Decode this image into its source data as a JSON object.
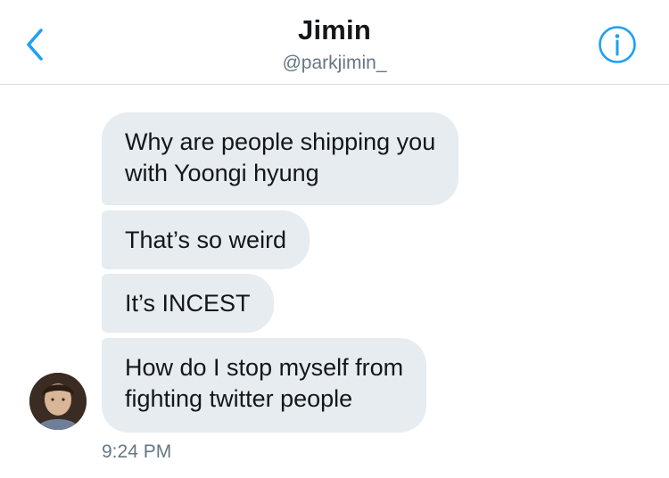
{
  "header": {
    "back_icon": "chevron-left-icon",
    "title": "Jimin",
    "subtitle": "@parkjimin_",
    "info_icon": "info-circle-icon"
  },
  "colors": {
    "accent": "#1da1f2",
    "bubble": "#e6ecf0",
    "text": "#14171a",
    "secondary_text": "#657786"
  },
  "messages": [
    {
      "lines": [
        "Why are people shipping you",
        "with Yoongi hyung"
      ]
    },
    {
      "lines": [
        "That’s so weird"
      ]
    },
    {
      "lines": [
        "It’s INCEST"
      ]
    },
    {
      "lines": [
        "How do I stop myself from",
        "fighting twitter people"
      ]
    }
  ],
  "timestamp": "9:24 PM"
}
